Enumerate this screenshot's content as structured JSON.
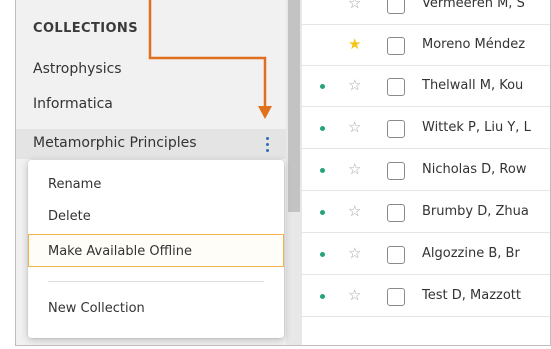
{
  "sidebar": {
    "section_title": "COLLECTIONS",
    "collections": [
      {
        "label": "Astrophysics"
      },
      {
        "label": "Informatica"
      },
      {
        "label": "Metamorphic Principles"
      }
    ]
  },
  "context_menu": {
    "items": [
      {
        "label": "Rename"
      },
      {
        "label": "Delete"
      },
      {
        "label": "Make Available Offline"
      },
      {
        "label": "New Collection"
      }
    ]
  },
  "list": {
    "rows": [
      {
        "authors": "Vermeeren M, S",
        "starred": false,
        "unread": false
      },
      {
        "authors": "Moreno Méndez",
        "starred": true,
        "unread": false
      },
      {
        "authors": "Thelwall M, Kou",
        "starred": false,
        "unread": true
      },
      {
        "authors": "Wittek P, Liu Y, L",
        "starred": false,
        "unread": true
      },
      {
        "authors": "Nicholas D, Row",
        "starred": false,
        "unread": true
      },
      {
        "authors": "Brumby D, Zhua",
        "starred": false,
        "unread": true
      },
      {
        "authors": "Algozzine B, Br",
        "starred": false,
        "unread": true
      },
      {
        "authors": "Test D, Mazzott",
        "starred": false,
        "unread": true
      }
    ]
  },
  "icons": {
    "star_filled": "★",
    "star_empty": "☆",
    "kebab": "more-vertical-icon"
  },
  "colors": {
    "accent": "#2f6db3",
    "star": "#f5c518",
    "unread_dot": "#27a37c",
    "highlight_border": "#f0b24a",
    "annotation": "#e0701e"
  }
}
